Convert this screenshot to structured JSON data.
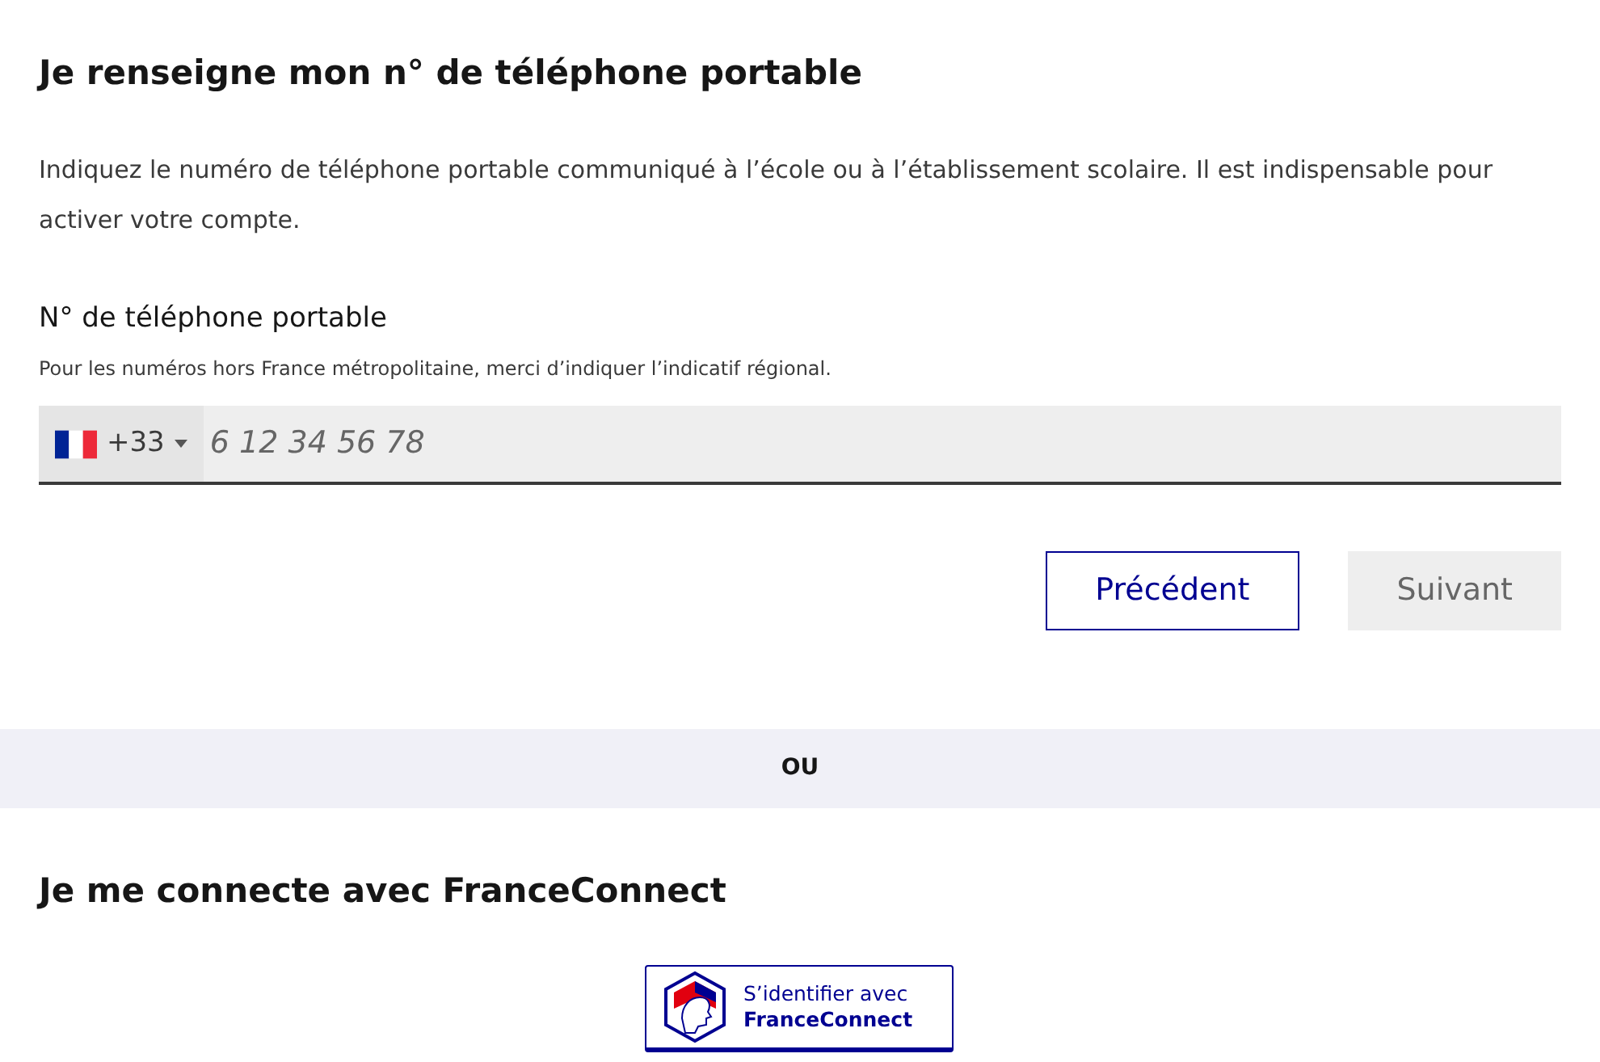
{
  "phone_section": {
    "title": "Je renseigne mon n° de téléphone portable",
    "description": "Indiquez le numéro de téléphone portable communiqué à l’école ou à l’établissement scolaire. Il est indispensable pour activer votre compte.",
    "field": {
      "label": "N° de téléphone portable",
      "hint": "Pour les numéros hors France métropolitaine, merci d’indiquer l’indicatif régional.",
      "country_code": "+33",
      "placeholder": "6 12 34 56 78"
    },
    "buttons": [
      {
        "label": "Précédent",
        "kind": "secondary",
        "disabled": false
      },
      {
        "label": "Suivant",
        "kind": "primary",
        "disabled": true
      }
    ]
  },
  "separator": "OU",
  "franceconnect_section": {
    "title": "Je me connecte avec FranceConnect",
    "button": {
      "line_1": "S’identifier avec",
      "line_2": "FranceConnect"
    }
  }
}
